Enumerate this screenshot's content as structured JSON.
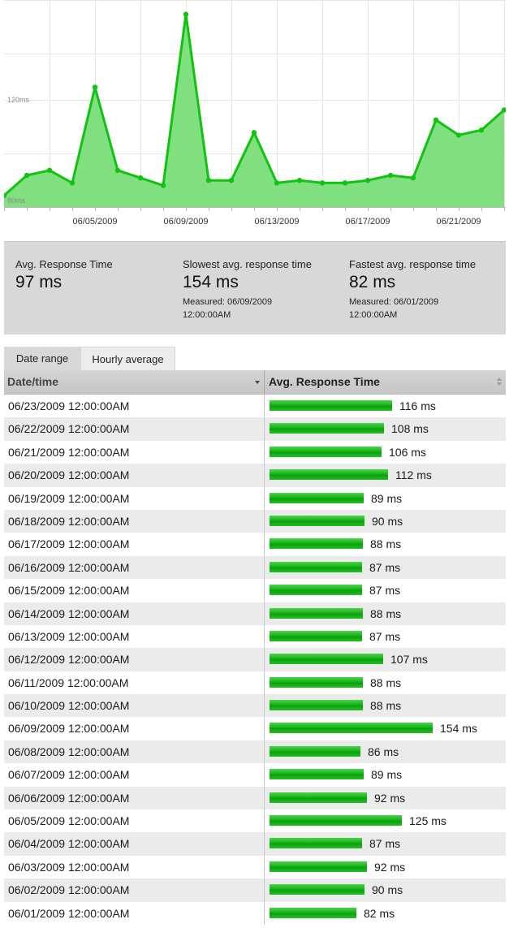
{
  "chart_data": {
    "type": "area",
    "x_ticks": [
      "06/05/2009",
      "06/09/2009",
      "06/13/2009",
      "06/17/2009",
      "06/21/2009"
    ],
    "y_tick_labels": [
      "80ms",
      "120ms"
    ],
    "y_range": [
      80,
      160
    ],
    "grid": true,
    "fill_color": "#80e080",
    "line_color": "#11c311",
    "series": [
      {
        "x": [
          "06/01/2009",
          "06/02/2009",
          "06/03/2009",
          "06/04/2009",
          "06/05/2009",
          "06/06/2009",
          "06/07/2009",
          "06/08/2009",
          "06/09/2009",
          "06/10/2009",
          "06/11/2009",
          "06/12/2009",
          "06/13/2009",
          "06/14/2009",
          "06/15/2009",
          "06/16/2009",
          "06/17/2009",
          "06/18/2009",
          "06/19/2009",
          "06/20/2009",
          "06/21/2009",
          "06/22/2009",
          "06/23/2009"
        ],
        "values": [
          82,
          90,
          92,
          87,
          125,
          92,
          89,
          86,
          154,
          88,
          88,
          107,
          87,
          88,
          87,
          87,
          88,
          90,
          89,
          112,
          106,
          108,
          116
        ]
      }
    ]
  },
  "stats": {
    "avg": {
      "label": "Avg. Response Time",
      "value": "97 ms"
    },
    "slowest": {
      "label": "Slowest avg. response time",
      "value": "154 ms",
      "measured": "Measured: 06/09/2009 12:00:00AM"
    },
    "fastest": {
      "label": "Fastest avg. response time",
      "value": "82 ms",
      "measured": "Measured: 06/01/2009 12:00:00AM"
    }
  },
  "tabs": [
    {
      "label": "Date range",
      "active": true
    },
    {
      "label": "Hourly average",
      "active": false
    }
  ],
  "table": {
    "headers": {
      "date": "Date/time",
      "response": "Avg. Response Time"
    },
    "bar_color": "#1cb91c",
    "rows": [
      {
        "date": "06/23/2009 12:00:00AM",
        "value": 116,
        "label": "116 ms"
      },
      {
        "date": "06/22/2009 12:00:00AM",
        "value": 108,
        "label": "108 ms"
      },
      {
        "date": "06/21/2009 12:00:00AM",
        "value": 106,
        "label": "106 ms"
      },
      {
        "date": "06/20/2009 12:00:00AM",
        "value": 112,
        "label": "112 ms"
      },
      {
        "date": "06/19/2009 12:00:00AM",
        "value": 89,
        "label": "89 ms"
      },
      {
        "date": "06/18/2009 12:00:00AM",
        "value": 90,
        "label": "90 ms"
      },
      {
        "date": "06/17/2009 12:00:00AM",
        "value": 88,
        "label": "88 ms"
      },
      {
        "date": "06/16/2009 12:00:00AM",
        "value": 87,
        "label": "87 ms"
      },
      {
        "date": "06/15/2009 12:00:00AM",
        "value": 87,
        "label": "87 ms"
      },
      {
        "date": "06/14/2009 12:00:00AM",
        "value": 88,
        "label": "88 ms"
      },
      {
        "date": "06/13/2009 12:00:00AM",
        "value": 87,
        "label": "87 ms"
      },
      {
        "date": "06/12/2009 12:00:00AM",
        "value": 107,
        "label": "107 ms"
      },
      {
        "date": "06/11/2009 12:00:00AM",
        "value": 88,
        "label": "88 ms"
      },
      {
        "date": "06/10/2009 12:00:00AM",
        "value": 88,
        "label": "88 ms"
      },
      {
        "date": "06/09/2009 12:00:00AM",
        "value": 154,
        "label": "154 ms"
      },
      {
        "date": "06/08/2009 12:00:00AM",
        "value": 86,
        "label": "86 ms"
      },
      {
        "date": "06/07/2009 12:00:00AM",
        "value": 89,
        "label": "89 ms"
      },
      {
        "date": "06/06/2009 12:00:00AM",
        "value": 92,
        "label": "92 ms"
      },
      {
        "date": "06/05/2009 12:00:00AM",
        "value": 125,
        "label": "125 ms"
      },
      {
        "date": "06/04/2009 12:00:00AM",
        "value": 87,
        "label": "87 ms"
      },
      {
        "date": "06/03/2009 12:00:00AM",
        "value": 92,
        "label": "92 ms"
      },
      {
        "date": "06/02/2009 12:00:00AM",
        "value": 90,
        "label": "90 ms"
      },
      {
        "date": "06/01/2009 12:00:00AM",
        "value": 82,
        "label": "82 ms"
      }
    ]
  }
}
